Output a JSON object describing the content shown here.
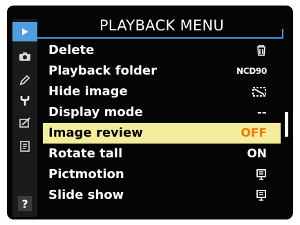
{
  "menu": {
    "title": "PLAYBACK MENU"
  },
  "tabs": [
    {
      "name": "playback-tab-icon",
      "active": true
    },
    {
      "name": "camera-tab-icon",
      "active": false
    },
    {
      "name": "pencil-tab-icon",
      "active": false
    },
    {
      "name": "wrench-tab-icon",
      "active": false
    },
    {
      "name": "retouch-tab-icon",
      "active": false
    },
    {
      "name": "my-menu-tab-icon",
      "active": false
    }
  ],
  "help": {
    "label": "?"
  },
  "items": [
    {
      "label": "Delete",
      "value": "",
      "icon": "trash-icon"
    },
    {
      "label": "Playback folder",
      "value": "NCD90"
    },
    {
      "label": "Hide image",
      "value": "",
      "icon": "hide-image-icon"
    },
    {
      "label": "Display mode",
      "value": "--"
    },
    {
      "label": "Image review",
      "value": "OFF",
      "selected": true
    },
    {
      "label": "Rotate tall",
      "value": "ON"
    },
    {
      "label": "Pictmotion",
      "value": "",
      "icon": "pictmotion-icon"
    },
    {
      "label": "Slide show",
      "value": "",
      "icon": "slideshow-icon"
    }
  ],
  "colors": {
    "accent": "#3d9be6",
    "selected_bg": "#f4ee9c",
    "selected_value": "#ee7a00",
    "background": "#050505"
  }
}
